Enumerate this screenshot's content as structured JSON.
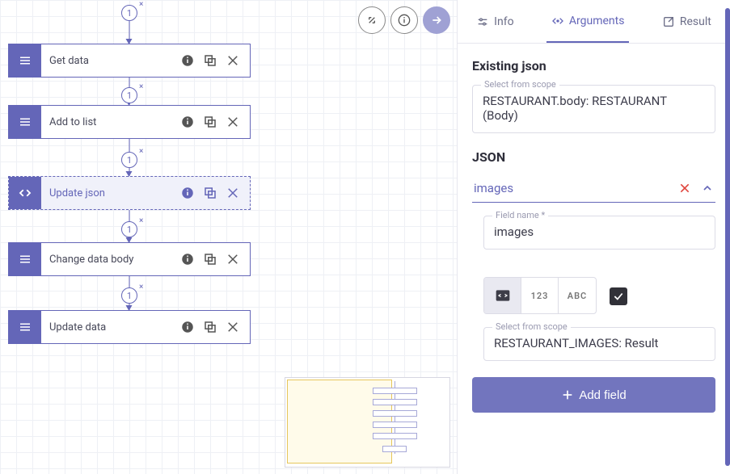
{
  "tabs": {
    "info": "Info",
    "arguments": "Arguments",
    "result": "Result",
    "active": "arguments"
  },
  "canvas": {
    "nodes": [
      {
        "id": "get-data",
        "label": "Get data",
        "selected": false
      },
      {
        "id": "add-to-list",
        "label": "Add to list",
        "selected": false
      },
      {
        "id": "update-json",
        "label": "Update json",
        "selected": true
      },
      {
        "id": "change-data-body",
        "label": "Change data body",
        "selected": false
      },
      {
        "id": "update-data",
        "label": "Update data",
        "selected": false
      }
    ],
    "badge_value": "1"
  },
  "panel": {
    "existing_json": {
      "title": "Existing json",
      "scope_label": "Select from scope",
      "scope_value": "RESTAURANT.body: RESTAURANT (Body)"
    },
    "json": {
      "title": "JSON",
      "entry_name": "images",
      "field_name_label": "Field name *",
      "field_name_value": "images",
      "type_options": {
        "code": "code",
        "num": "123",
        "str": "ABC"
      },
      "scope_label": "Select from scope",
      "scope_value": "RESTAURANT_IMAGES: Result"
    },
    "add_field_label": "Add field"
  }
}
